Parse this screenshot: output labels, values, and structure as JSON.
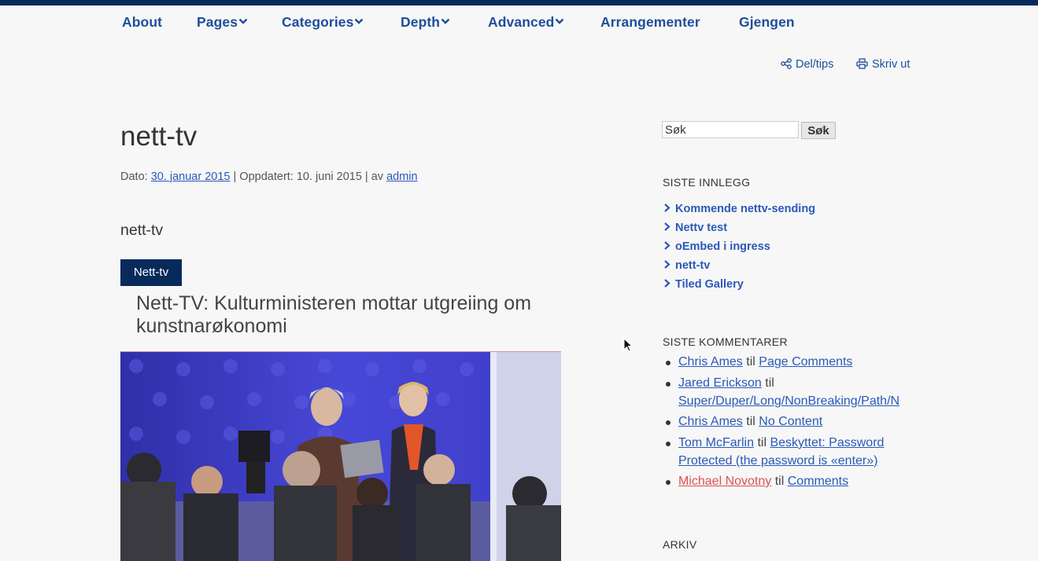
{
  "nav": {
    "items": [
      {
        "label": "About",
        "dropdown": false
      },
      {
        "label": "Pages",
        "dropdown": true
      },
      {
        "label": "Categories",
        "dropdown": true
      },
      {
        "label": "Depth",
        "dropdown": true
      },
      {
        "label": "Advanced",
        "dropdown": true
      },
      {
        "label": "Arrangementer",
        "dropdown": false
      },
      {
        "label": "Gjengen",
        "dropdown": false
      }
    ]
  },
  "utilities": {
    "share_label": "Del/tips",
    "print_label": "Skriv ut"
  },
  "post": {
    "title": "nett-tv",
    "meta": {
      "date_prefix": "Dato:",
      "date": "30. januar 2015",
      "updated": "| Oppdatert: 10. juni 2015 | av",
      "author": "admin"
    },
    "subtitle": "nett-tv",
    "badge": "Nett-tv",
    "video_title": "Nett-TV: Kulturministeren mottar utgreiing om kunstnarøkonomi"
  },
  "sidebar": {
    "search": {
      "value": "Søk",
      "button_label": "Søk"
    },
    "recent_posts": {
      "title": "SISTE INNLEGG",
      "items": [
        "Kommende nettv-sending",
        "Nettv test",
        "oEmbed i ingress",
        "nett-tv",
        "Tiled Gallery"
      ]
    },
    "recent_comments": {
      "title": "SISTE KOMMENTARER",
      "connector": "til",
      "items": [
        {
          "author": "Chris Ames",
          "post_line1": "Page Comments",
          "post_line2": ""
        },
        {
          "author": "Jared Erickson",
          "post_line1": "",
          "post_line2": "Super/Duper/Long/NonBreaking/Path/N"
        },
        {
          "author": "Chris Ames",
          "post_line1": "No Content",
          "post_line2": ""
        },
        {
          "author": "Tom McFarlin",
          "post_line1": "Beskyttet: Password",
          "post_line2": "Protected (the password is «enter»)"
        },
        {
          "author": "Michael Novotny",
          "post_line1": "Comments",
          "post_line2": ""
        }
      ]
    },
    "archive": {
      "title": "ARKIV"
    }
  },
  "colors": {
    "brand_navy": "#072a5b",
    "link_blue": "#2a59b8",
    "nav_blue": "#1e4e9a",
    "comment_red": "#d9534f"
  }
}
